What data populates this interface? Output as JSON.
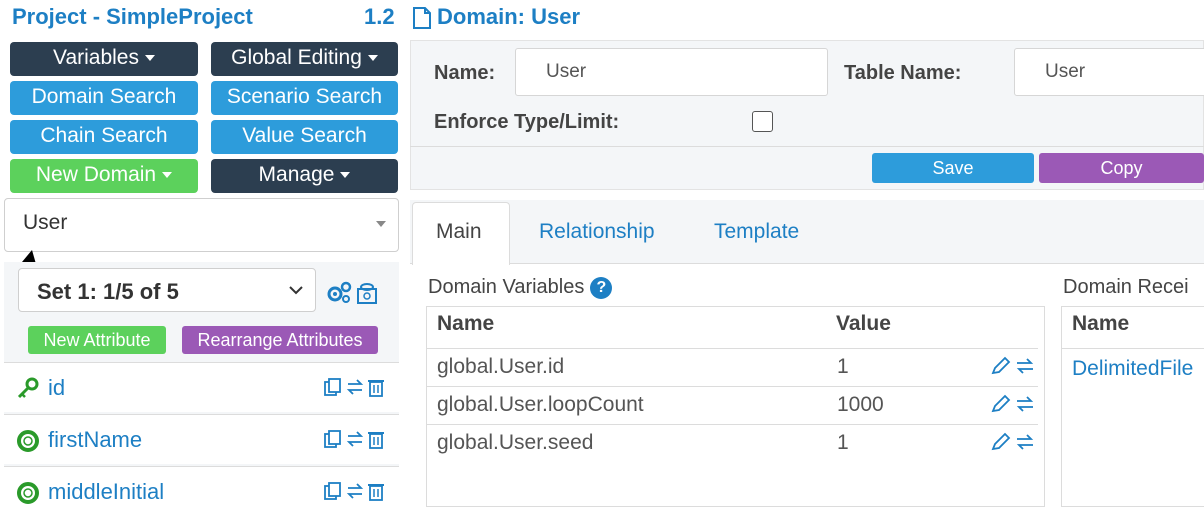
{
  "sidebar": {
    "project_title": "Project - SimpleProject",
    "buttons": {
      "variables": "Variables",
      "global_editing": "Global Editing",
      "domain_search": "Domain Search",
      "scenario_search": "Scenario Search",
      "chain_search": "Chain Search",
      "value_search": "Value Search",
      "new_domain": "New Domain",
      "manage": "Manage"
    },
    "domain_select": "User",
    "set_select": "Set 1: 1/5 of 5",
    "new_attribute": "New Attribute",
    "rearrange_attributes": "Rearrange Attributes",
    "attributes": [
      {
        "name": "id",
        "icon": "key-icon"
      },
      {
        "name": "firstName",
        "icon": "lifebuoy-icon"
      },
      {
        "name": "middleInitial",
        "icon": "lifebuoy-icon"
      }
    ]
  },
  "header": {
    "version": "1.2",
    "domain_title": "Domain: User"
  },
  "form": {
    "name_label": "Name:",
    "name_value": "User",
    "table_name_label": "Table Name:",
    "table_name_value": "User",
    "enforce_label": "Enforce Type/Limit:",
    "enforce_checked": false,
    "save": "Save",
    "copy": "Copy"
  },
  "tabs": [
    {
      "label": "Main",
      "active": true
    },
    {
      "label": "Relationship",
      "active": false
    },
    {
      "label": "Template",
      "active": false
    }
  ],
  "domain_variables": {
    "title": "Domain Variables",
    "columns": [
      "Name",
      "Value"
    ],
    "rows": [
      {
        "name": "global.User.id",
        "value": "1"
      },
      {
        "name": "global.User.loopCount",
        "value": "1000"
      },
      {
        "name": "global.User.seed",
        "value": "1"
      }
    ]
  },
  "domain_receivers": {
    "title": "Domain Recei",
    "columns": [
      "Name"
    ],
    "rows": [
      {
        "name": "DelimitedFile"
      }
    ]
  },
  "colors": {
    "accent_blue": "#1d7fc4",
    "button_blue": "#2d9cdb",
    "button_dark": "#2c3e50",
    "button_green": "#5cd15c",
    "button_purple": "#9b59b6"
  }
}
